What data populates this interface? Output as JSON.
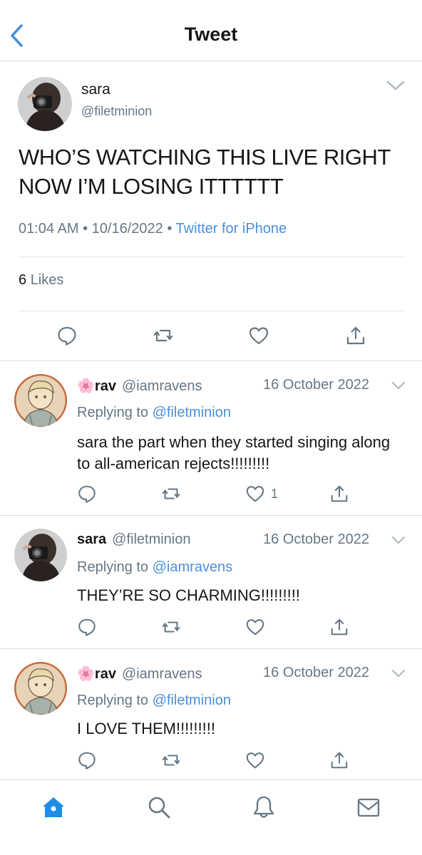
{
  "header": {
    "title": "Tweet"
  },
  "main_tweet": {
    "name": "sara",
    "handle": "@filetminion",
    "text": "WHO’S WATCHING THIS LIVE RIGHT NOW I’M LOSING ITTTTTT",
    "time": "01:04 AM",
    "date": "10/16/2022",
    "source": "Twitter for iPhone",
    "likes_count": "6",
    "likes_label": "Likes"
  },
  "replies": [
    {
      "emoji": "🌸",
      "name": "rav",
      "handle": "@iamravens",
      "date": "16 October 2022",
      "replying_label": "Replying to",
      "replying_to": "@filetminion",
      "text": "sara the part when they started singing along to all-american rejects!!!!!!!!!",
      "like_count": "1"
    },
    {
      "emoji": "",
      "name": "sara",
      "handle": "@filetminion",
      "date": "16 October 2022",
      "replying_label": "Replying to",
      "replying_to": "@iamravens",
      "text": "THEY’RE SO CHARMING!!!!!!!!!",
      "like_count": ""
    },
    {
      "emoji": "🌸",
      "name": "rav",
      "handle": "@iamravens",
      "date": "16 October 2022",
      "replying_label": "Replying to",
      "replying_to": "@filetminion",
      "text": "I LOVE THEM!!!!!!!!!",
      "like_count": ""
    }
  ],
  "tabbar": {
    "items": [
      "home-icon",
      "search-icon",
      "notifications-icon",
      "messages-icon"
    ],
    "active": "home-icon"
  },
  "colors": {
    "accent": "#4a90d9",
    "text": "#14171a",
    "muted": "#657786",
    "divider": "#d8dadc"
  }
}
